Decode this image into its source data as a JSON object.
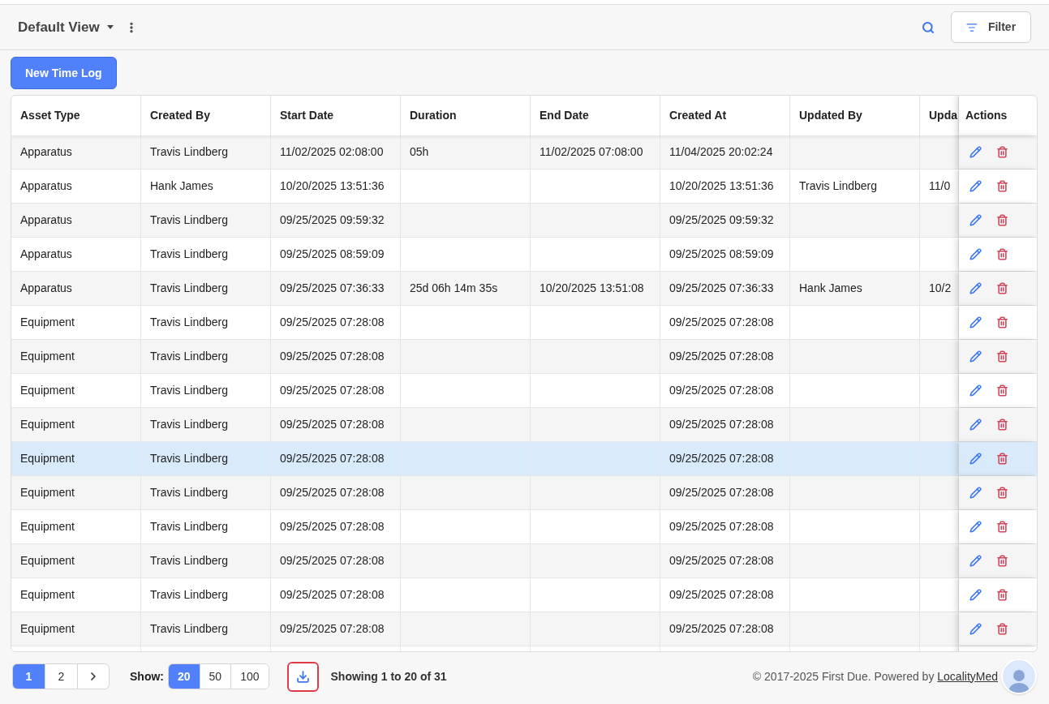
{
  "toolbar": {
    "view_title": "Default View",
    "filter_button": "Filter"
  },
  "new_button": "New Time Log",
  "table": {
    "columns": [
      "Asset Type",
      "Created By",
      "Start Date",
      "Duration",
      "End Date",
      "Created At",
      "Updated By",
      "Upda"
    ],
    "actions_column": "Actions",
    "rows": [
      {
        "cells": [
          "Apparatus",
          "Travis Lindberg",
          "11/02/2025 02:08:00",
          "05h",
          "11/02/2025 07:08:00",
          "11/04/2025 20:02:24",
          "",
          ""
        ],
        "highlighted": false
      },
      {
        "cells": [
          "Apparatus",
          "Hank James",
          "10/20/2025 13:51:36",
          "",
          "",
          "10/20/2025 13:51:36",
          "Travis Lindberg",
          "11/0"
        ],
        "highlighted": false
      },
      {
        "cells": [
          "Apparatus",
          "Travis Lindberg",
          "09/25/2025 09:59:32",
          "",
          "",
          "09/25/2025 09:59:32",
          "",
          ""
        ],
        "highlighted": false
      },
      {
        "cells": [
          "Apparatus",
          "Travis Lindberg",
          "09/25/2025 08:59:09",
          "",
          "",
          "09/25/2025 08:59:09",
          "",
          ""
        ],
        "highlighted": false
      },
      {
        "cells": [
          "Apparatus",
          "Travis Lindberg",
          "09/25/2025 07:36:33",
          "25d 06h 14m 35s",
          "10/20/2025 13:51:08",
          "09/25/2025 07:36:33",
          "Hank James",
          "10/2"
        ],
        "highlighted": false
      },
      {
        "cells": [
          "Equipment",
          "Travis Lindberg",
          "09/25/2025 07:28:08",
          "",
          "",
          "09/25/2025 07:28:08",
          "",
          ""
        ],
        "highlighted": false
      },
      {
        "cells": [
          "Equipment",
          "Travis Lindberg",
          "09/25/2025 07:28:08",
          "",
          "",
          "09/25/2025 07:28:08",
          "",
          ""
        ],
        "highlighted": false
      },
      {
        "cells": [
          "Equipment",
          "Travis Lindberg",
          "09/25/2025 07:28:08",
          "",
          "",
          "09/25/2025 07:28:08",
          "",
          ""
        ],
        "highlighted": false
      },
      {
        "cells": [
          "Equipment",
          "Travis Lindberg",
          "09/25/2025 07:28:08",
          "",
          "",
          "09/25/2025 07:28:08",
          "",
          ""
        ],
        "highlighted": false
      },
      {
        "cells": [
          "Equipment",
          "Travis Lindberg",
          "09/25/2025 07:28:08",
          "",
          "",
          "09/25/2025 07:28:08",
          "",
          ""
        ],
        "highlighted": true
      },
      {
        "cells": [
          "Equipment",
          "Travis Lindberg",
          "09/25/2025 07:28:08",
          "",
          "",
          "09/25/2025 07:28:08",
          "",
          ""
        ],
        "highlighted": false
      },
      {
        "cells": [
          "Equipment",
          "Travis Lindberg",
          "09/25/2025 07:28:08",
          "",
          "",
          "09/25/2025 07:28:08",
          "",
          ""
        ],
        "highlighted": false
      },
      {
        "cells": [
          "Equipment",
          "Travis Lindberg",
          "09/25/2025 07:28:08",
          "",
          "",
          "09/25/2025 07:28:08",
          "",
          ""
        ],
        "highlighted": false
      },
      {
        "cells": [
          "Equipment",
          "Travis Lindberg",
          "09/25/2025 07:28:08",
          "",
          "",
          "09/25/2025 07:28:08",
          "",
          ""
        ],
        "highlighted": false
      },
      {
        "cells": [
          "Equipment",
          "Travis Lindberg",
          "09/25/2025 07:28:08",
          "",
          "",
          "09/25/2025 07:28:08",
          "",
          ""
        ],
        "highlighted": false
      }
    ]
  },
  "pagination": {
    "pages": [
      {
        "label": "1",
        "selected": true
      },
      {
        "label": "2",
        "selected": false
      }
    ],
    "show_label": "Show:",
    "page_sizes": [
      {
        "label": "20",
        "selected": true
      },
      {
        "label": "50",
        "selected": false
      },
      {
        "label": "100",
        "selected": false
      }
    ],
    "download_focused": true,
    "summary": "Showing 1 to 20 of 31"
  },
  "footer": {
    "copyright": "© 2017-2025 First Due. Powered by ",
    "link": "LocalityMed"
  }
}
